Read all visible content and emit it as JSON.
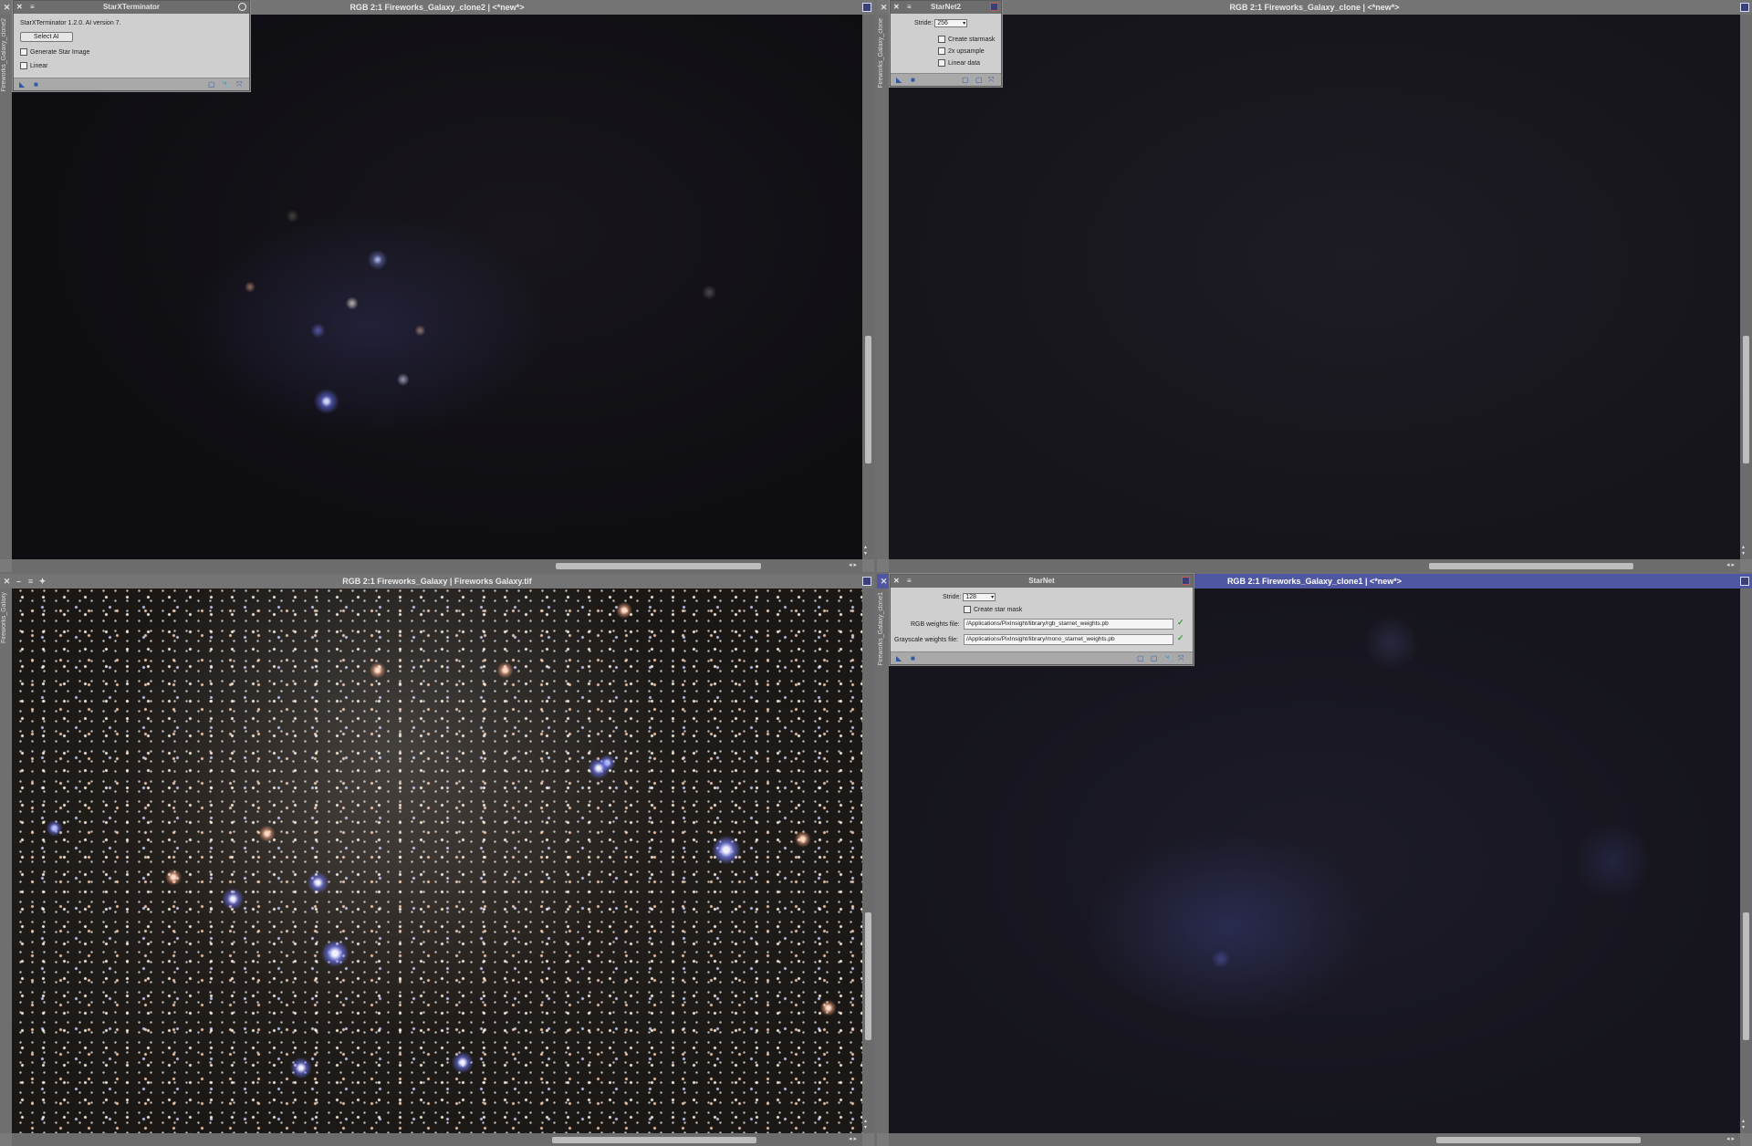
{
  "windows": {
    "top_left": {
      "title": "RGB 2:1 Fireworks_Galaxy_clone2 | <*new*>",
      "side_label": "Fireworks_Galaxy_clone2"
    },
    "top_right": {
      "title": "RGB 2:1 Fireworks_Galaxy_clone | <*new*>",
      "side_label": "Fireworks_Galaxy_clone"
    },
    "bottom_left": {
      "title": "RGB 2:1 Fireworks_Galaxy | Fireworks Galaxy.tif",
      "side_label": "Fireworks_Galaxy"
    },
    "bottom_right": {
      "title": "RGB 2:1 Fireworks_Galaxy_clone1 | <*new*>",
      "side_label": "Fireworks_Galaxy_clone1",
      "active_color": "#4f57a3"
    }
  },
  "starxterminator": {
    "title": "StarXTerminator",
    "version_text": "StarXTerminator 1.2.0. AI version 7.",
    "select_ai_label": "Select AI",
    "generate_star_image_label": "Generate Star Image",
    "linear_label": "Linear"
  },
  "starnet2": {
    "title": "StarNet2",
    "stride_label": "Stride:",
    "stride_value": "256",
    "create_starmask_label": "Create starmask",
    "upsample_label": "2x upsample",
    "linear_data_label": "Linear data"
  },
  "starnet": {
    "title": "StarNet",
    "stride_label": "Stride:",
    "stride_value": "128",
    "create_star_mask_label": "Create star mask",
    "rgb_weights_label": "RGB weights file:",
    "rgb_weights_value": "/Applications/PixInsight/library/rgb_starnet_weights.pb",
    "gray_weights_label": "Grayscale weights file:",
    "gray_weights_value": "/Applications/PixInsight/library/mono_starnet_weights.pb",
    "check_color": "#2fa43a"
  },
  "glyphs": {
    "close": "✕",
    "shade": "≡",
    "minimize": "–",
    "pin": "✦",
    "apply": "◣",
    "square": "■",
    "new_instance": "▢",
    "doc": "🗋",
    "wrench": "🔧",
    "reset": "⤧",
    "left": "◂",
    "right": "▸",
    "up": "▴",
    "down": "▾"
  }
}
